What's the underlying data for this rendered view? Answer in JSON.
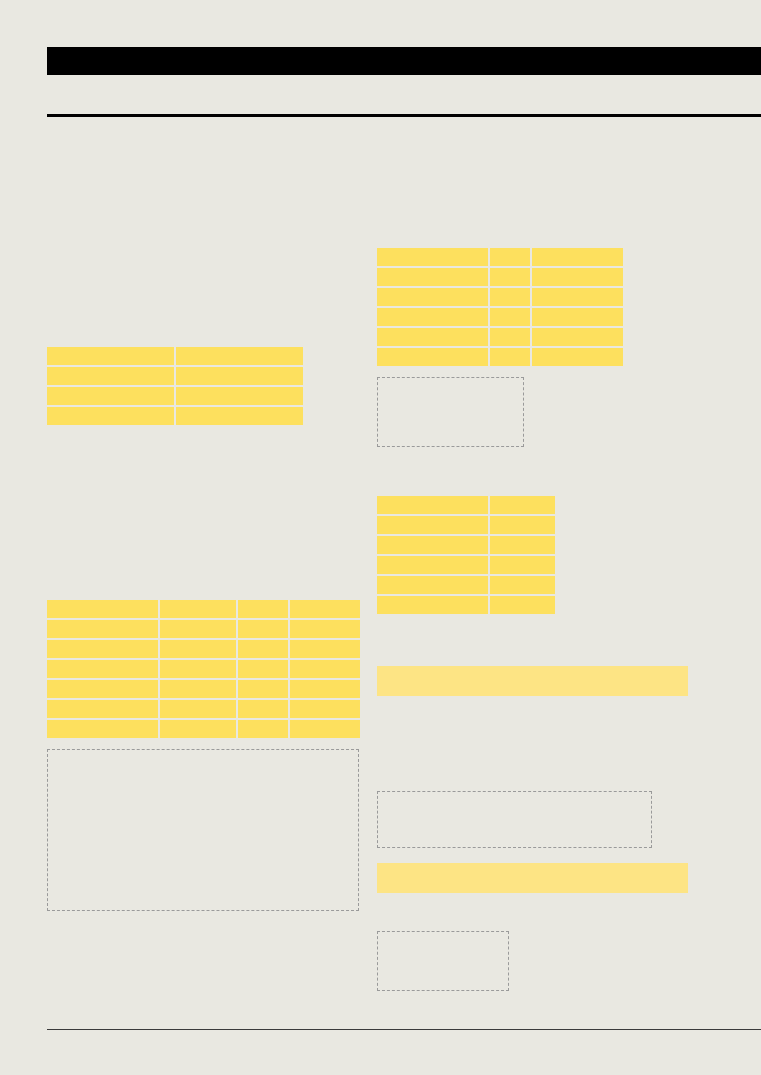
{
  "document": {
    "colors": {
      "page_background": "#e9e8e1",
      "header_bar": "#000000",
      "table_cell_fill": "#fde05e",
      "callout_band_fill": "#fde484",
      "placeholder_box_border": "#9a9a9a"
    },
    "header": {
      "title": ""
    },
    "tables": [
      {
        "name": "table-a",
        "columns": 2,
        "rows": 4
      },
      {
        "name": "table-b",
        "columns": 4,
        "rows": 7
      },
      {
        "name": "table-c",
        "columns": 3,
        "rows": 6
      },
      {
        "name": "table-d",
        "columns": 2,
        "rows": 6
      }
    ],
    "placeholder_boxes": 4,
    "callout_bands": 2
  }
}
